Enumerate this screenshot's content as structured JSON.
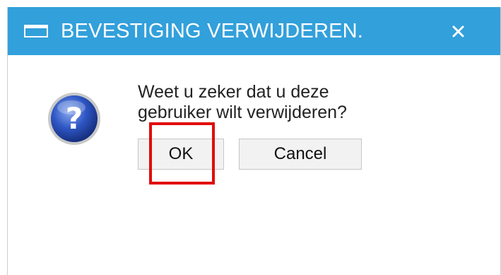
{
  "dialog": {
    "title": "BEVESTIGING VERWIJDEREN.",
    "title_icon": "window-icon",
    "close_icon": "close-icon",
    "question_icon": "question-icon",
    "message_line1": "Weet u zeker dat u deze",
    "message_line2": "gebruiker wilt verwijderen?",
    "ok_label": "OK",
    "cancel_label": "Cancel"
  },
  "colors": {
    "titlebar": "#32a0db",
    "highlight": "#e10b0b"
  }
}
